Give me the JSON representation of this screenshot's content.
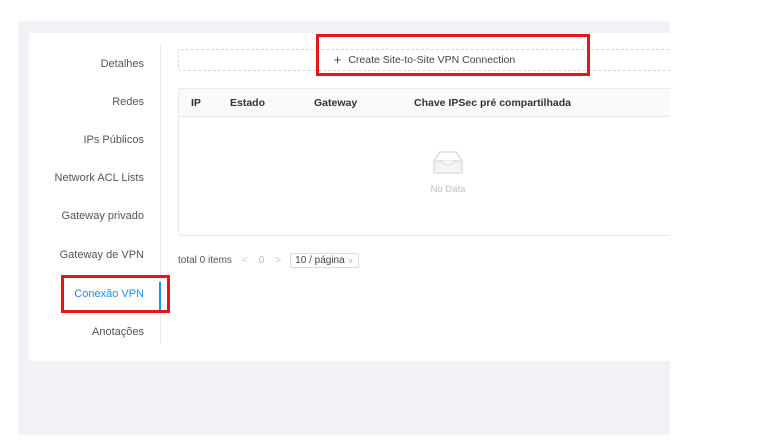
{
  "sidebar": {
    "items": [
      {
        "label": "Detalhes"
      },
      {
        "label": "Redes"
      },
      {
        "label": "IPs Públicos"
      },
      {
        "label": "Network ACL Lists"
      },
      {
        "label": "Gateway privado"
      },
      {
        "label": "Gateway de VPN"
      },
      {
        "label": "Conexão VPN",
        "active": true
      },
      {
        "label": "Anotações"
      }
    ]
  },
  "toolbar": {
    "create_label": "Create Site-to-Site VPN Connection",
    "plus_icon": "+"
  },
  "table": {
    "columns": [
      "IP",
      "Estado",
      "Gateway",
      "Chave IPSec pré compartilhada"
    ],
    "rows": [],
    "empty_text": "No Data"
  },
  "pagination": {
    "total_text": "total 0 items",
    "prev_icon": "<",
    "current_page": "0",
    "next_icon": ">",
    "page_size": "10 / página"
  },
  "colors": {
    "accent": "#1890ff",
    "highlight": "#e8141b"
  }
}
